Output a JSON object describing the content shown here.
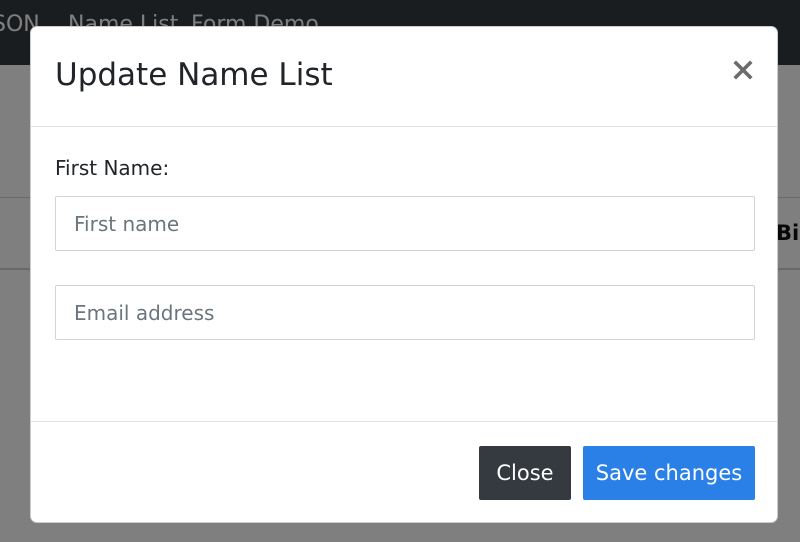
{
  "app": {
    "navbar": {
      "brand": "SON",
      "links": [
        "Name List",
        "Form Demo"
      ]
    },
    "table_header_peek": "Bi"
  },
  "modal": {
    "title": "Update Name List",
    "close_icon": "close-icon",
    "first_name_label": "First Name:",
    "first_name": {
      "value": "",
      "placeholder": "First name"
    },
    "email": {
      "value": "",
      "placeholder": "Email address"
    },
    "buttons": {
      "close_label": "Close",
      "save_label": "Save changes"
    }
  },
  "colors": {
    "navbar_bg": "#343a40",
    "close_button_bg": "#343a40",
    "save_button_bg": "#2a80e6",
    "overlay": "rgba(0,0,0,0.5)"
  }
}
